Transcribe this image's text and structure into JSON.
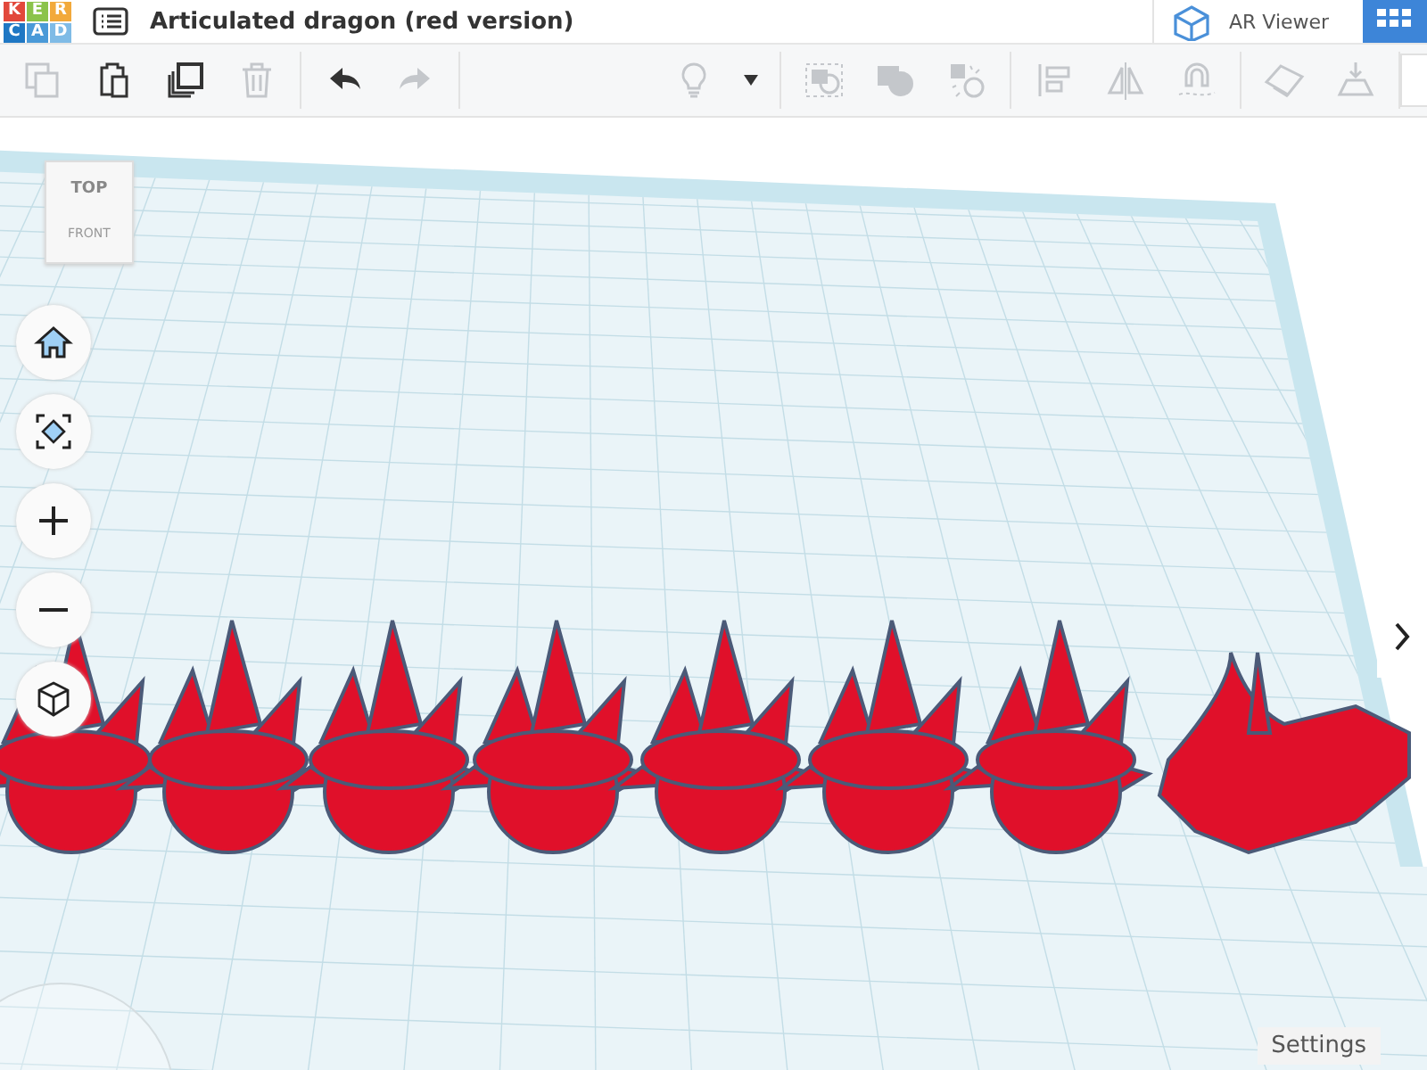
{
  "header": {
    "logo_letters": [
      "K",
      "E",
      "R",
      "C",
      "A",
      "D"
    ],
    "title": "Articulated dragon (red version)",
    "ar_viewer": "AR Viewer"
  },
  "toolbar": {
    "left_groups": [
      {
        "tools": [
          {
            "kind": "copy",
            "disabled": true
          },
          {
            "kind": "paste",
            "disabled": false
          },
          {
            "kind": "duplicate",
            "disabled": false
          },
          {
            "kind": "delete",
            "disabled": true
          }
        ]
      },
      {
        "tools": [
          {
            "kind": "undo",
            "disabled": false
          },
          {
            "kind": "redo",
            "disabled": true
          }
        ]
      }
    ],
    "right_groups": [
      {
        "tools": [
          {
            "kind": "bulb",
            "disabled": true
          },
          {
            "kind": "caret",
            "disabled": false
          }
        ]
      },
      {
        "tools": [
          {
            "kind": "group",
            "disabled": true
          },
          {
            "kind": "union",
            "disabled": true
          },
          {
            "kind": "ungroup",
            "disabled": true
          }
        ]
      },
      {
        "tools": [
          {
            "kind": "align",
            "disabled": true
          },
          {
            "kind": "mirror",
            "disabled": true
          },
          {
            "kind": "magnet",
            "disabled": true
          }
        ]
      },
      {
        "tools": [
          {
            "kind": "workplane",
            "disabled": true
          },
          {
            "kind": "drop",
            "disabled": true
          }
        ]
      }
    ]
  },
  "view_cube": {
    "top": "TOP",
    "front": "FRONT"
  },
  "nav_buttons": [
    {
      "kind": "home"
    },
    {
      "kind": "fit"
    },
    {
      "kind": "zoom_in"
    },
    {
      "kind": "zoom_out"
    },
    {
      "kind": "perspective"
    }
  ],
  "settings": "Settings"
}
